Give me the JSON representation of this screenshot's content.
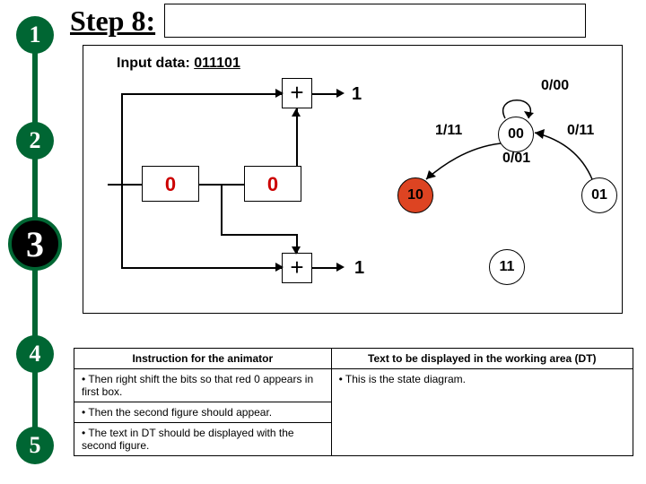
{
  "title": "Step 8:",
  "input_label": "Input data:",
  "input_value": "011101",
  "circuit": {
    "reg1": "0",
    "reg2": "0",
    "adder_top": "+",
    "adder_bot": "+",
    "out_top": "1",
    "out_bot": "1"
  },
  "state_diagram": {
    "states": {
      "s00": "00",
      "s01": "01",
      "s10": "10",
      "s11": "11"
    },
    "edges": {
      "l00_self": "0/00",
      "l00_10": "1/11",
      "l10_01": "0/01",
      "l01_00": "0/11"
    }
  },
  "steps": [
    "1",
    "2",
    "3",
    "4",
    "5"
  ],
  "active_step": "3",
  "table": {
    "header_left": "Instruction for the animator",
    "header_right": "Text to be displayed in the working area (DT)",
    "rows": [
      {
        "left": "• Then right shift the bits so that red 0 appears in first box.",
        "right": "• This is the state diagram."
      },
      {
        "left": "• Then the second figure should appear.",
        "right": ""
      },
      {
        "left": "• The text in DT should be displayed with the second figure.",
        "right": ""
      }
    ]
  }
}
